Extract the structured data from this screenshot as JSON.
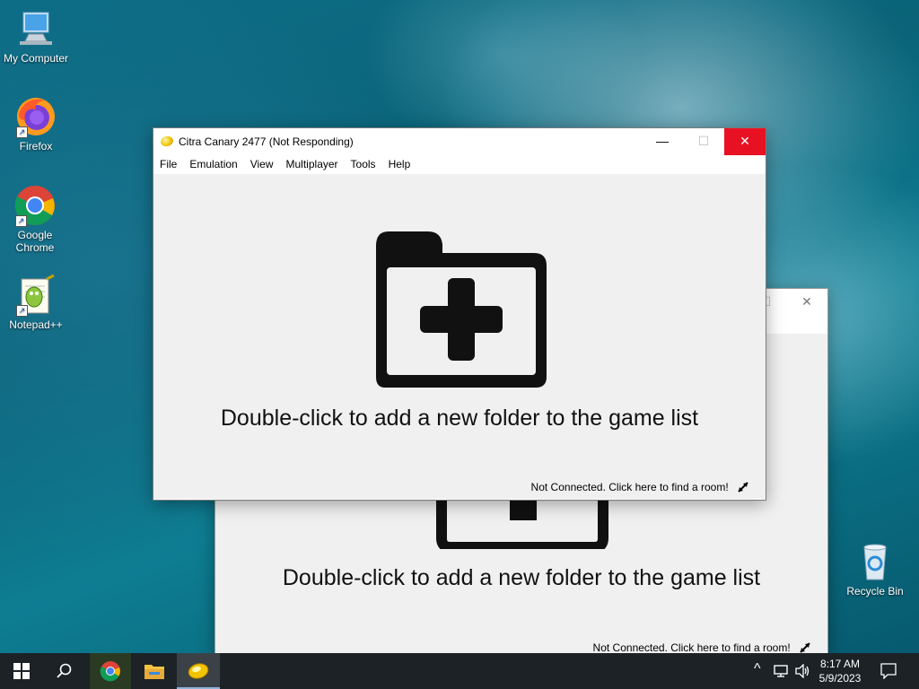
{
  "desktop": {
    "icons": [
      {
        "label": "My Computer",
        "icon": "computer-icon"
      },
      {
        "label": "Firefox",
        "icon": "firefox-icon"
      },
      {
        "label": "Google Chrome",
        "icon": "chrome-icon"
      },
      {
        "label": "Notepad++",
        "icon": "notepadpp-icon"
      },
      {
        "label": "Recycle Bin",
        "icon": "recycle-bin-icon"
      }
    ]
  },
  "front_window": {
    "title": "Citra Canary 2477  (Not Responding)",
    "menu": [
      "File",
      "Emulation",
      "View",
      "Multiplayer",
      "Tools",
      "Help"
    ],
    "placeholder": "Double-click to add a new folder to the game list",
    "status": "Not Connected. Click here to find a room!",
    "controls": {
      "minimize": "—",
      "maximize": "☐",
      "close": "✕"
    }
  },
  "back_window": {
    "placeholder": "Double-click to add a new folder to the game list",
    "status": "Not Connected. Click here to find a room!",
    "controls": {
      "maximize": "☐",
      "close": "✕"
    }
  },
  "taskbar": {
    "clock_time": "8:17 AM",
    "clock_date": "5/9/2023",
    "tray_chevron": "^"
  },
  "colors": {
    "close_hover": "#e81123",
    "taskbar": "#1c2226",
    "client_bg": "#f0f0f0"
  }
}
